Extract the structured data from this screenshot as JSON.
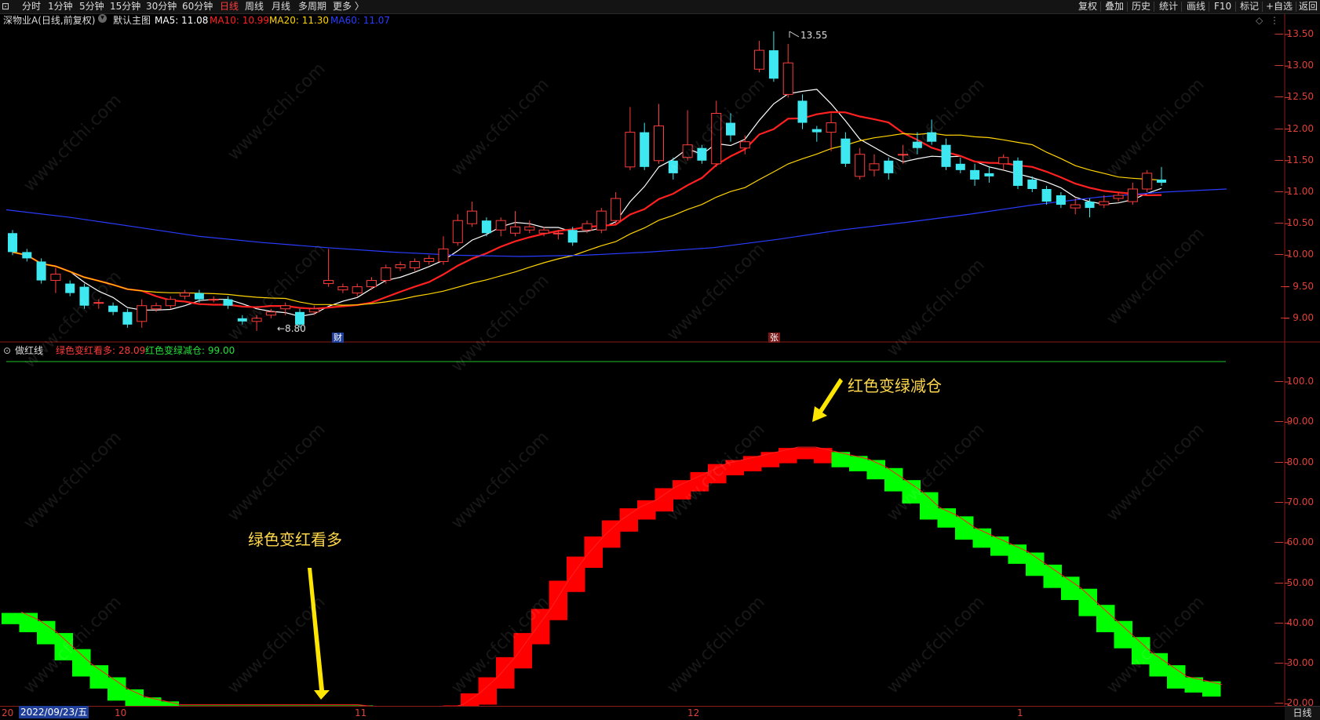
{
  "toolbar": {
    "items": [
      "分时",
      "1分钟",
      "5分钟",
      "15分钟",
      "30分钟",
      "60分钟",
      "日线",
      "周线",
      "月线",
      "多周期",
      "更多 〉"
    ],
    "active": "日线",
    "right_items": [
      "复权",
      "叠加",
      "历史",
      "统计",
      "画线",
      "F10",
      "标记",
      "+自选",
      "返回"
    ]
  },
  "stock": {
    "name": "深物业A(日线,前复权)",
    "template": "默认主图",
    "ma5_label": "MA5: 11.08",
    "ma10_label": "MA10: 10.99",
    "ma20_label": "MA20: 11.30",
    "ma60_label": "MA60: 11.07"
  },
  "colors": {
    "ma5": "#ffffff",
    "ma10": "#ff2020",
    "ma20": "#ffd400",
    "ma60": "#2a3cff",
    "up": "#ff3b3b",
    "down": "#3ee8f0",
    "bull_band": "#ff0000",
    "bear_band": "#00ff00",
    "axis": "#e0403a"
  },
  "price_axis": [
    "13.50",
    "13.00",
    "12.50",
    "12.00",
    "11.50",
    "11.00",
    "10.50",
    "10.00",
    "9.50",
    "9.00"
  ],
  "markers": {
    "high": "13.55",
    "low": "←8.80",
    "cai": "财",
    "zhang": "张"
  },
  "indicator": {
    "name": "做红线",
    "label1": "绿色变红看多: 28.09",
    "label2": "红色变绿减仓: 99.00"
  },
  "ind_axis": [
    "100.0",
    "90.00",
    "80.00",
    "70.00",
    "60.00",
    "50.00",
    "40.00",
    "30.00",
    "20.00"
  ],
  "annotations": {
    "buy": "绿色变红看多",
    "sell": "红色变绿减仓"
  },
  "xaxis": {
    "date": "2022/09/23/五",
    "prefix": "20",
    "months": [
      "10",
      "11",
      "12",
      "1"
    ]
  },
  "bottom_right": "日线",
  "watermark": "www.cfchi.com"
}
